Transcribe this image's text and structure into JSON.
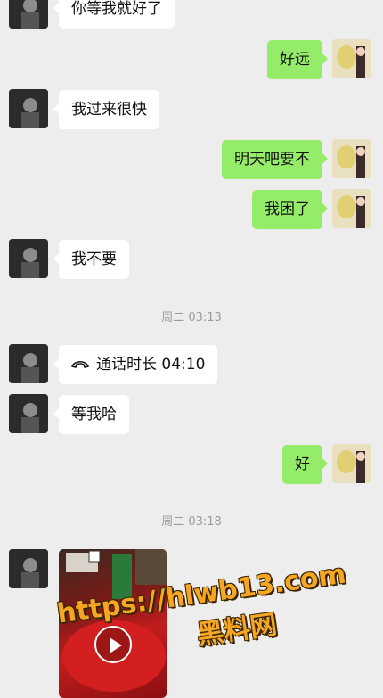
{
  "messages": [
    {
      "side": "left",
      "text": "你等我就好了"
    },
    {
      "side": "right",
      "text": "好远"
    },
    {
      "side": "left",
      "text": "我过来很快"
    },
    {
      "side": "right",
      "text": "明天吧要不"
    },
    {
      "side": "right",
      "text": "我困了"
    },
    {
      "side": "left",
      "text": "我不要"
    },
    {
      "side": "time",
      "text": "周二 03:13"
    },
    {
      "side": "left",
      "text": "通话时长 04:10",
      "icon": "phone-icon"
    },
    {
      "side": "left",
      "text": "等我哈"
    },
    {
      "side": "right",
      "text": "好"
    },
    {
      "side": "time",
      "text": "周二 03:18"
    },
    {
      "side": "left",
      "type": "video"
    }
  ],
  "watermark": {
    "line1": "https://hlwb13.com",
    "line2": "黑料网",
    "color": "#F5A623"
  },
  "colors": {
    "background": "#EDEDED",
    "sent_bubble": "#95EC69",
    "received_bubble": "#FFFFFF"
  }
}
